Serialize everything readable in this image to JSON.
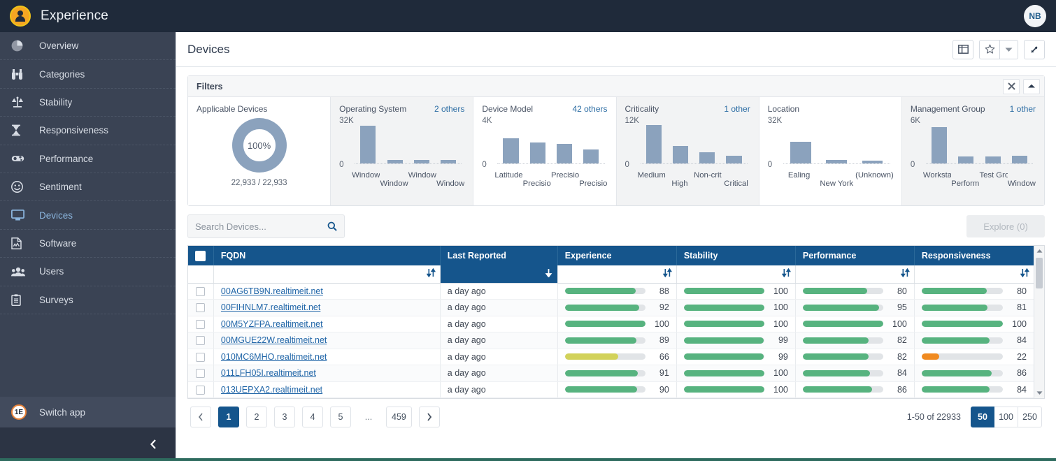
{
  "app": {
    "brand_title": "Experience",
    "avatar_initials": "NB",
    "logo_icon": "user-circle-logo"
  },
  "sidebar": {
    "items": [
      {
        "label": "Overview",
        "icon": "pie-chart-icon",
        "active": false
      },
      {
        "label": "Categories",
        "icon": "binoculars-icon",
        "active": false
      },
      {
        "label": "Stability",
        "icon": "scales-icon",
        "active": false
      },
      {
        "label": "Responsiveness",
        "icon": "hourglass-icon",
        "active": false
      },
      {
        "label": "Performance",
        "icon": "gauge-icon",
        "active": false
      },
      {
        "label": "Sentiment",
        "icon": "smiley-icon",
        "active": false
      },
      {
        "label": "Devices",
        "icon": "monitor-icon",
        "active": true
      },
      {
        "label": "Software",
        "icon": "document-chart-icon",
        "active": false
      },
      {
        "label": "Users",
        "icon": "people-icon",
        "active": false
      },
      {
        "label": "Surveys",
        "icon": "clipboard-icon",
        "active": false
      }
    ],
    "switch_app_label": "Switch app",
    "switch_app_badge": "1E",
    "collapse_icon": "chevron-left-icon"
  },
  "header": {
    "title": "Devices",
    "buttons": [
      {
        "name": "columns-button",
        "icon": "columns-icon"
      },
      {
        "name": "favorite-button",
        "icon": "star-icon"
      },
      {
        "name": "favorite-dropdown-button",
        "icon": "caret-down-icon"
      },
      {
        "name": "expand-button",
        "icon": "expand-arrows-icon"
      }
    ]
  },
  "filters": {
    "title": "Filters",
    "close_icon": "close-icon",
    "collapse_icon": "chevron-up-icon",
    "applicable": {
      "title": "Applicable Devices",
      "percent": "100%",
      "count": "22,933 / 22,933",
      "percent_value": 100
    },
    "cards": [
      {
        "title": "Operating System",
        "others": "2 others",
        "max_label": "32K",
        "zero_label": "0",
        "chart_data": {
          "type": "bar",
          "categories": [
            "Windows ...",
            "Windows ...",
            "Windows ...",
            "Window..."
          ],
          "values": [
            30000,
            2600,
            2600,
            2600
          ],
          "ylim": [
            0,
            32000
          ],
          "title": "Operating System",
          "xlabel": "",
          "ylabel": ""
        }
      },
      {
        "title": "Device Model",
        "others": "42 others",
        "max_label": "4K",
        "zero_label": "0",
        "chart_data": {
          "type": "bar",
          "categories": [
            "Latitude 7...",
            "Precision ...",
            "Precision ...",
            "Precisio..."
          ],
          "values": [
            2500,
            2050,
            1900,
            1400
          ],
          "ylim": [
            0,
            4000
          ],
          "title": "Device Model",
          "xlabel": "",
          "ylabel": ""
        }
      },
      {
        "title": "Criticality",
        "others": "1 other",
        "max_label": "12K",
        "zero_label": "0",
        "chart_data": {
          "type": "bar",
          "categories": [
            "Medium",
            "High",
            "Non-critical",
            "Critical"
          ],
          "values": [
            11300,
            5200,
            3400,
            2200
          ],
          "ylim": [
            0,
            12000
          ],
          "title": "Criticality",
          "xlabel": "",
          "ylabel": ""
        }
      },
      {
        "title": "Location",
        "others": "",
        "max_label": "32K",
        "zero_label": "0",
        "chart_data": {
          "type": "bar",
          "categories": [
            "Ealing",
            "New York",
            "(Unknown)"
          ],
          "values": [
            17000,
            2500,
            2400
          ],
          "ylim": [
            0,
            32000
          ],
          "title": "Location",
          "xlabel": "",
          "ylabel": ""
        }
      },
      {
        "title": "Management Group",
        "others": "1 other",
        "max_label": "6K",
        "zero_label": "0",
        "chart_data": {
          "type": "bar",
          "categories": [
            "Workstati...",
            "Performa...",
            "Test Group",
            "Window..."
          ],
          "values": [
            5400,
            1000,
            1000,
            1100
          ],
          "ylim": [
            0,
            6000
          ],
          "title": "Management Group",
          "xlabel": "",
          "ylabel": ""
        }
      }
    ]
  },
  "search": {
    "placeholder": "Search Devices...",
    "value": "",
    "icon": "search-icon"
  },
  "explore": {
    "label": "Explore (0)",
    "enabled": false
  },
  "table": {
    "columns": [
      {
        "key": "check",
        "label": ""
      },
      {
        "key": "fqdn",
        "label": "FQDN",
        "sort": "none"
      },
      {
        "key": "last_reported",
        "label": "Last Reported",
        "sort": "desc"
      },
      {
        "key": "experience",
        "label": "Experience",
        "sort": "none"
      },
      {
        "key": "stability",
        "label": "Stability",
        "sort": "none"
      },
      {
        "key": "performance",
        "label": "Performance",
        "sort": "none"
      },
      {
        "key": "responsiveness",
        "label": "Responsiveness",
        "sort": "none"
      }
    ],
    "rows": [
      {
        "fqdn": "00AG6TB9N.realtimeit.net",
        "last_reported": "a day ago",
        "experience": 88,
        "experience_color": "#57b37f",
        "stability": 100,
        "stability_color": "#57b37f",
        "performance": 80,
        "performance_color": "#57b37f",
        "responsiveness": 80,
        "responsiveness_color": "#57b37f"
      },
      {
        "fqdn": "00FIHNLM7.realtimeit.net",
        "last_reported": "a day ago",
        "experience": 92,
        "experience_color": "#57b37f",
        "stability": 100,
        "stability_color": "#57b37f",
        "performance": 95,
        "performance_color": "#57b37f",
        "responsiveness": 81,
        "responsiveness_color": "#57b37f"
      },
      {
        "fqdn": "00M5YZFPA.realtimeit.net",
        "last_reported": "a day ago",
        "experience": 100,
        "experience_color": "#57b37f",
        "stability": 100,
        "stability_color": "#57b37f",
        "performance": 100,
        "performance_color": "#57b37f",
        "responsiveness": 100,
        "responsiveness_color": "#57b37f"
      },
      {
        "fqdn": "00MGUE22W.realtimeit.net",
        "last_reported": "a day ago",
        "experience": 89,
        "experience_color": "#57b37f",
        "stability": 99,
        "stability_color": "#57b37f",
        "performance": 82,
        "performance_color": "#57b37f",
        "responsiveness": 84,
        "responsiveness_color": "#57b37f"
      },
      {
        "fqdn": "010MC6MHO.realtimeit.net",
        "last_reported": "a day ago",
        "experience": 66,
        "experience_color": "#d2d25a",
        "stability": 99,
        "stability_color": "#57b37f",
        "performance": 82,
        "performance_color": "#57b37f",
        "responsiveness": 22,
        "responsiveness_color": "#f08a20"
      },
      {
        "fqdn": "011LFH05I.realtimeit.net",
        "last_reported": "a day ago",
        "experience": 91,
        "experience_color": "#57b37f",
        "stability": 100,
        "stability_color": "#57b37f",
        "performance": 84,
        "performance_color": "#57b37f",
        "responsiveness": 86,
        "responsiveness_color": "#57b37f"
      },
      {
        "fqdn": "013UEPXA2.realtimeit.net",
        "last_reported": "a day ago",
        "experience": 90,
        "experience_color": "#57b37f",
        "stability": 100,
        "stability_color": "#57b37f",
        "performance": 86,
        "performance_color": "#57b37f",
        "responsiveness": 84,
        "responsiveness_color": "#57b37f"
      }
    ]
  },
  "pagination": {
    "prev_icon": "chevron-left-icon",
    "next_icon": "chevron-right-icon",
    "pages": [
      "1",
      "2",
      "3",
      "4",
      "5",
      "...",
      "459"
    ],
    "current_page": "1",
    "range_text": "1-50 of 22933",
    "page_sizes": [
      "50",
      "100",
      "250"
    ],
    "current_size": "50"
  }
}
